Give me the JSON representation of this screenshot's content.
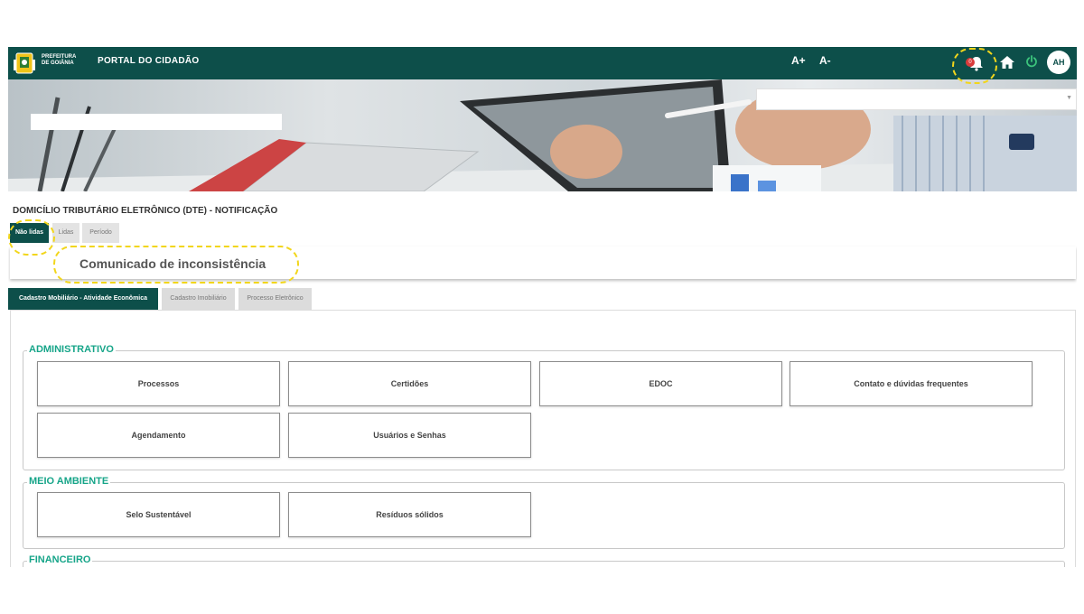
{
  "header": {
    "logo_line1": "PREFEITURA",
    "logo_line2": "DE GOIÂNIA",
    "portal_title": "PORTAL DO CIDADÃO",
    "font_increase": "A+",
    "font_decrease": "A-",
    "notification_count": "0",
    "user_initials": "AH"
  },
  "page": {
    "section_title": "DOMICÍLIO TRIBUTÁRIO ELETRÔNICO (DTE) - NOTIFICAÇÃO"
  },
  "notification_tabs": [
    {
      "label": "Não lidas",
      "active": true
    },
    {
      "label": "Lidas",
      "active": false
    },
    {
      "label": "Período",
      "active": false
    }
  ],
  "notice": {
    "text": "Comunicado de inconsistência"
  },
  "category_tabs": [
    {
      "label": "Cadastro Mobiliário - Atividade Econômica",
      "active": true
    },
    {
      "label": "Cadastro Imobiliário",
      "active": false
    },
    {
      "label": "Processo Eletrônico",
      "active": false
    }
  ],
  "groups": [
    {
      "title": "ADMINISTRATIVO",
      "items": [
        "Processos",
        "Certidões",
        "EDOC",
        "Contato e dúvidas frequentes",
        "Agendamento",
        "Usuários e Senhas"
      ]
    },
    {
      "title": "MEIO AMBIENTE",
      "items": [
        "Selo Sustentável",
        "Resíduos sólidos"
      ]
    },
    {
      "title": "FINANCEIRO",
      "items": []
    }
  ],
  "colors": {
    "primary": "#0d4f4a",
    "legend": "#17a589",
    "highlight": "#f2d61b",
    "badge": "#d93b3b"
  }
}
